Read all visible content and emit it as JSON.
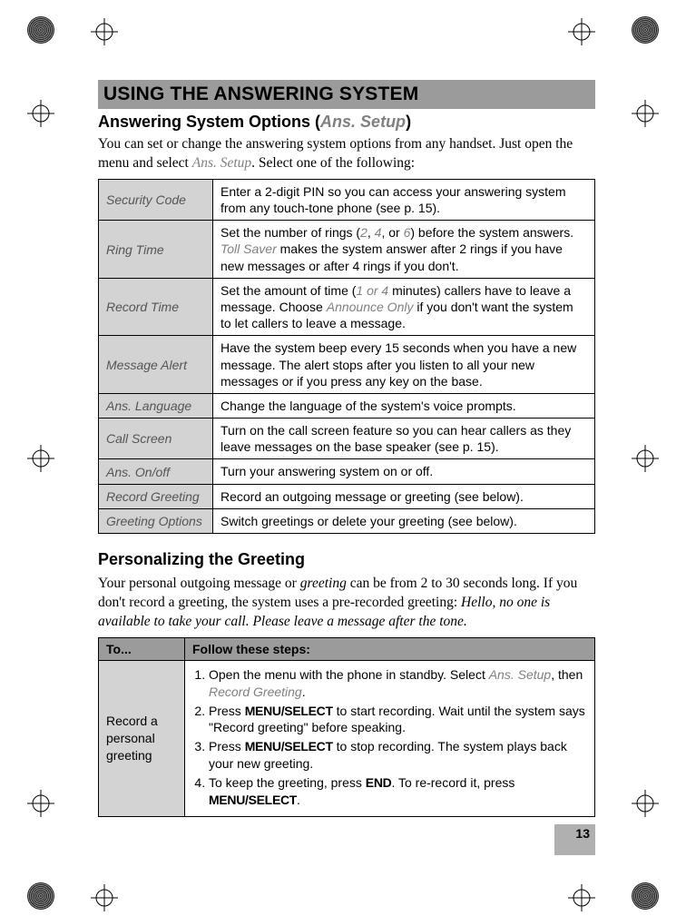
{
  "section_heading": "USING THE ANSWERING SYSTEM",
  "subheading": {
    "prefix": "Answering System Options (",
    "italic": "Ans. Setup",
    "suffix": ")"
  },
  "intro": {
    "before": "You can set or change the answering system options from any handset. Just open the menu and select ",
    "menu_item": "Ans. Setup",
    "after": ". Select one of the following:"
  },
  "options": [
    {
      "label": "Security Code",
      "desc_parts": [
        {
          "t": "Enter a 2-digit PIN so you can access your answering system from any touch-tone phone (see p. 15)."
        }
      ]
    },
    {
      "label": "Ring Time",
      "desc_parts": [
        {
          "t": "Set the number of rings ("
        },
        {
          "t": "2",
          "i": true
        },
        {
          "t": ", "
        },
        {
          "t": "4",
          "i": true
        },
        {
          "t": ", or "
        },
        {
          "t": "6",
          "i": true
        },
        {
          "t": ") before the system answers. "
        },
        {
          "t": "Toll Saver",
          "i": true
        },
        {
          "t": " makes the system answer after 2 rings if you have new messages or after 4 rings if you don't."
        }
      ]
    },
    {
      "label": "Record Time",
      "desc_parts": [
        {
          "t": "Set the amount of time ("
        },
        {
          "t": "1 or 4",
          "i": true
        },
        {
          "t": " minutes) callers have to leave a message. Choose "
        },
        {
          "t": "Announce Only",
          "i": true
        },
        {
          "t": " if you don't want the system to let callers to leave a message."
        }
      ]
    },
    {
      "label": "Message Alert",
      "desc_parts": [
        {
          "t": "Have the system beep every 15 seconds when you have a new message. The alert stops after you listen to all your new messages or if you press any key on the base."
        }
      ]
    },
    {
      "label": "Ans. Language",
      "desc_parts": [
        {
          "t": "Change the language of the system's voice prompts."
        }
      ]
    },
    {
      "label": "Call Screen",
      "desc_parts": [
        {
          "t": "Turn on the call screen feature so you can hear callers as they leave messages on the base speaker (see p. 15)."
        }
      ]
    },
    {
      "label": "Ans. On/off",
      "desc_parts": [
        {
          "t": "Turn your answering system on or off."
        }
      ]
    },
    {
      "label": "Record Greeting",
      "desc_parts": [
        {
          "t": "Record an outgoing message or greeting (see below)."
        }
      ]
    },
    {
      "label": "Greeting Options",
      "desc_parts": [
        {
          "t": "Switch greetings or delete your greeting (see below)."
        }
      ]
    }
  ],
  "personalizing_heading": "Personalizing the Greeting",
  "personalizing_body": {
    "p1_before": "Your personal outgoing message or ",
    "p1_greeting": "greeting",
    "p1_mid": " can be from 2 to 30 seconds long. If you don't record a greeting, the system uses a pre-recorded greeting: ",
    "p1_quote": "Hello, no one is available to take your call. Please leave a message after the tone."
  },
  "steps_table": {
    "head_to": "To...",
    "head_follow": "Follow these steps:",
    "row_label": "Record a personal greeting",
    "steps": [
      [
        {
          "t": "Open the menu with the phone in standby. Select "
        },
        {
          "t": "Ans. Setup",
          "i": true
        },
        {
          "t": ", then "
        },
        {
          "t": "Record Greeting",
          "i": true
        },
        {
          "t": "."
        }
      ],
      [
        {
          "t": "Press "
        },
        {
          "t": "MENU/SELECT",
          "b": true
        },
        {
          "t": " to start recording. Wait until the system says  \"Record greeting\" before speaking."
        }
      ],
      [
        {
          "t": "Press "
        },
        {
          "t": "MENU/SELECT",
          "b": true
        },
        {
          "t": " to stop recording. The system plays back your new greeting."
        }
      ],
      [
        {
          "t": "To keep the greeting, press "
        },
        {
          "t": "END",
          "b": true
        },
        {
          "t": ". To re-record it, press "
        },
        {
          "t": "MENU/SELECT",
          "b": true
        },
        {
          "t": "."
        }
      ]
    ]
  },
  "page_number": "13"
}
